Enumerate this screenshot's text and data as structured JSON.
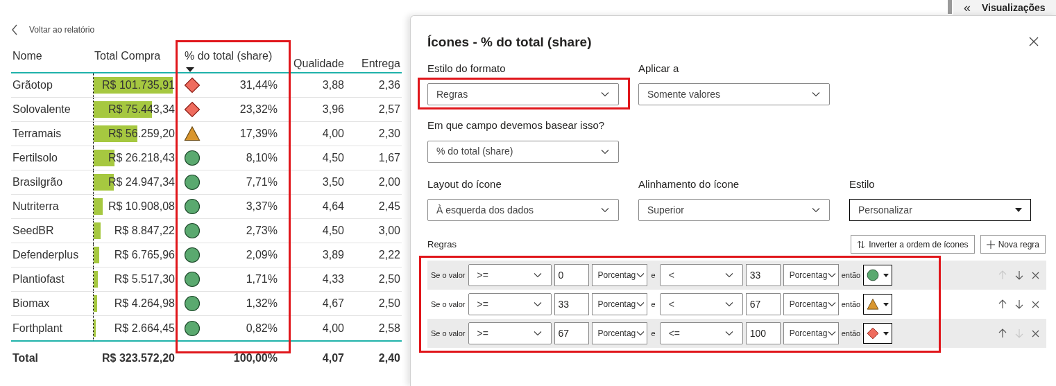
{
  "back_link": "Voltar ao relatório",
  "side_pane": {
    "collapse": "«",
    "title": "Visualizações"
  },
  "table": {
    "columns": [
      {
        "label": "Nome",
        "sorted": false
      },
      {
        "label": "Total Compra",
        "sorted": false
      },
      {
        "label": "% do total (share)",
        "sorted": true
      },
      {
        "label": "Qualidade",
        "sorted": false
      },
      {
        "label": "Entrega",
        "sorted": false
      }
    ],
    "rows": [
      {
        "name": "Grãotop",
        "total": "R$ 101.735,91",
        "level": 1.0,
        "kind": "diamond",
        "color": "#ef6c5e",
        "share": "31,44%",
        "quality": "3,88",
        "delivery": "2,36"
      },
      {
        "name": "Solovalente",
        "total": "R$ 75.443,34",
        "level": 0.74,
        "kind": "diamond",
        "color": "#ef6c5e",
        "share": "23,32%",
        "quality": "3,96",
        "delivery": "2,57"
      },
      {
        "name": "Terramais",
        "total": "R$ 56.259,20",
        "level": 0.55,
        "kind": "triangle",
        "color": "#d9962e",
        "share": "17,39%",
        "quality": "4,00",
        "delivery": "2,30"
      },
      {
        "name": "Fertilsolo",
        "total": "R$ 26.218,43",
        "level": 0.26,
        "kind": "circle",
        "color": "#5aa96f",
        "share": "8,10%",
        "quality": "4,50",
        "delivery": "1,67"
      },
      {
        "name": "Brasilgrão",
        "total": "R$ 24.947,34",
        "level": 0.25,
        "kind": "circle",
        "color": "#5aa96f",
        "share": "7,71%",
        "quality": "3,50",
        "delivery": "2,00"
      },
      {
        "name": "Nutriterra",
        "total": "R$ 10.908,08",
        "level": 0.11,
        "kind": "circle",
        "color": "#5aa96f",
        "share": "3,37%",
        "quality": "4,64",
        "delivery": "2,45"
      },
      {
        "name": "SeedBR",
        "total": "R$ 8.847,22",
        "level": 0.09,
        "kind": "circle",
        "color": "#5aa96f",
        "share": "2,73%",
        "quality": "4,50",
        "delivery": "3,00"
      },
      {
        "name": "Defenderplus",
        "total": "R$ 6.765,96",
        "level": 0.07,
        "kind": "circle",
        "color": "#5aa96f",
        "share": "2,09%",
        "quality": "3,89",
        "delivery": "2,22"
      },
      {
        "name": "Plantiofast",
        "total": "R$ 5.517,30",
        "level": 0.055,
        "kind": "circle",
        "color": "#5aa96f",
        "share": "1,71%",
        "quality": "4,33",
        "delivery": "2,50"
      },
      {
        "name": "Biomax",
        "total": "R$ 4.264,98",
        "level": 0.042,
        "kind": "circle",
        "color": "#5aa96f",
        "share": "1,32%",
        "quality": "4,67",
        "delivery": "2,50"
      },
      {
        "name": "Forthplant",
        "total": "R$ 2.664,45",
        "level": 0.026,
        "kind": "circle",
        "color": "#5aa96f",
        "share": "0,82%",
        "quality": "4,00",
        "delivery": "2,58"
      }
    ],
    "total": {
      "label": "Total",
      "total": "R$ 323.572,20",
      "share": "100,00%",
      "quality": "4,07",
      "delivery": "2,40"
    }
  },
  "dialog": {
    "title": "Ícones - % do total (share)",
    "fields": [
      {
        "label": "Estilo do formato",
        "value": "Regras"
      },
      {
        "label": "Aplicar a",
        "value": "Somente valores"
      },
      {
        "label": "Em que campo devemos basear isso?",
        "value": "% do total (share)"
      },
      {
        "label": "Layout do ícone",
        "value": "À esquerda dos dados"
      },
      {
        "label": "Alinhamento do ícone",
        "value": "Superior"
      },
      {
        "label": "Estilo",
        "value": "Personalizar"
      }
    ],
    "rules_label": "Regras",
    "buttons": [
      "Inverter a ordem de ícones",
      "Nova regra"
    ],
    "rules": [
      {
        "if": "Se o valor",
        "op1": ">=",
        "v1": "0",
        "unit1": "Porcentag",
        "and": "e",
        "op2": "<",
        "v2": "33",
        "unit2": "Porcentag",
        "then": "então",
        "kind": "circle",
        "color": "#5aa96f",
        "up_disabled": true,
        "down_disabled": false
      },
      {
        "if": "Se o valor",
        "op1": ">=",
        "v1": "33",
        "unit1": "Porcentag",
        "and": "e",
        "op2": "<",
        "v2": "67",
        "unit2": "Porcentag",
        "then": "então",
        "kind": "triangle",
        "color": "#d9962e",
        "up_disabled": false,
        "down_disabled": false
      },
      {
        "if": "Se o valor",
        "op1": ">=",
        "v1": "67",
        "unit1": "Porcentag",
        "and": "e",
        "op2": "<=",
        "v2": "100",
        "unit2": "Porcentag",
        "then": "então",
        "kind": "diamond",
        "color": "#ef6c5e",
        "up_disabled": false,
        "down_disabled": true
      }
    ]
  }
}
